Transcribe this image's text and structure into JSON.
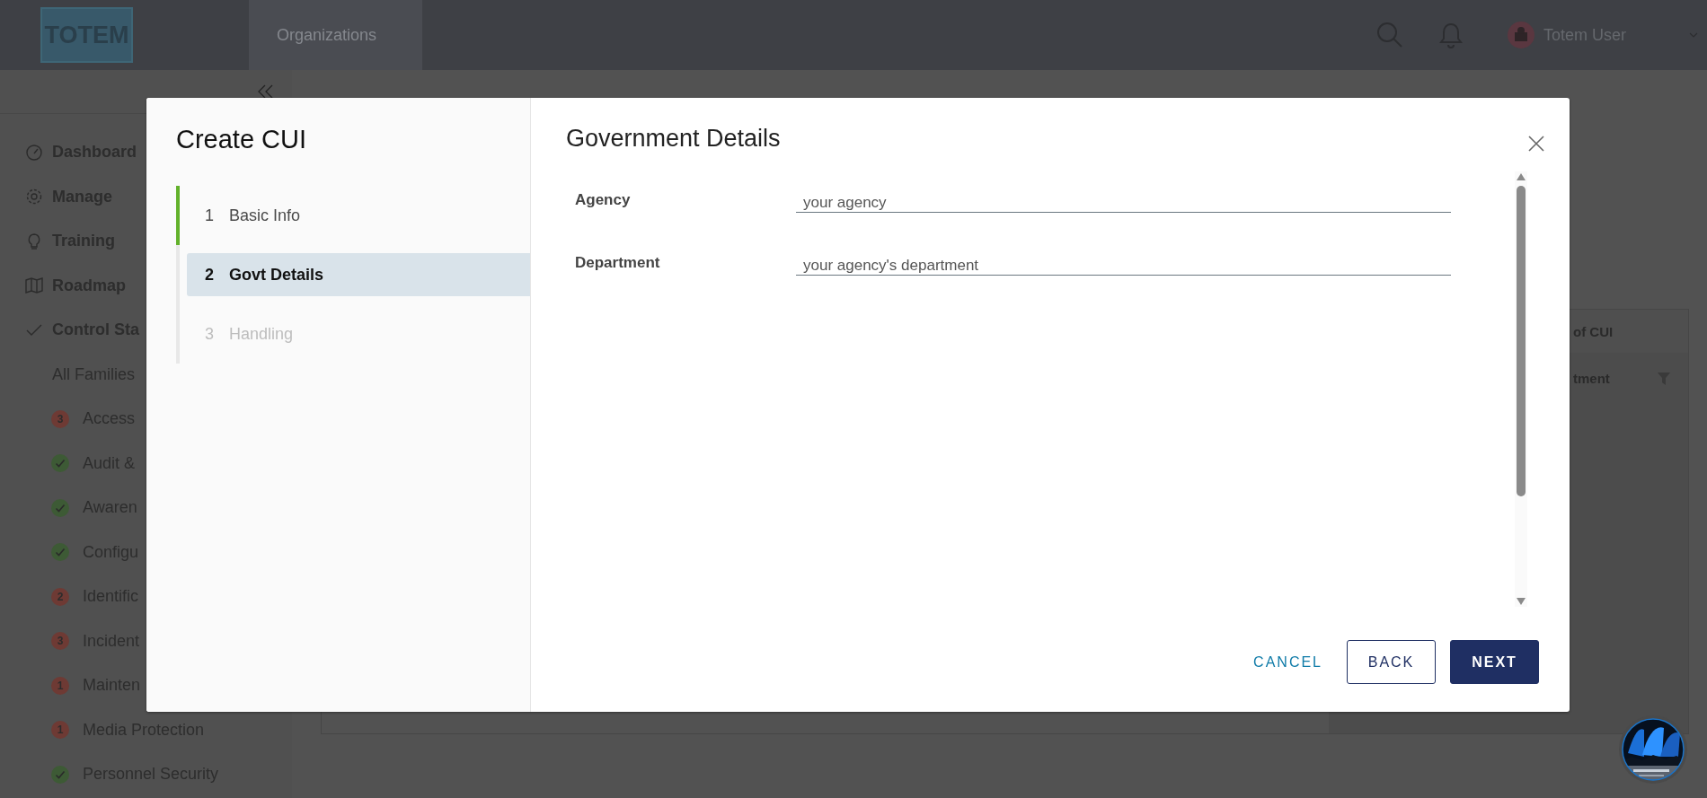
{
  "header": {
    "logo": "TOTEM",
    "nav": [
      {
        "label": "Organizations",
        "selected": true
      }
    ],
    "user": "Totem User"
  },
  "sidebar": {
    "items": [
      {
        "kind": "nav",
        "label": "Dashboard"
      },
      {
        "kind": "nav",
        "label": "Manage"
      },
      {
        "kind": "nav",
        "label": "Training"
      },
      {
        "kind": "nav",
        "label": "Roadmap"
      },
      {
        "kind": "nav",
        "label": "Control Sta"
      },
      {
        "kind": "sub",
        "label": "All Families"
      },
      {
        "kind": "family",
        "badge": "3",
        "color": "#6e3a34",
        "label": "Access"
      },
      {
        "kind": "family",
        "color": "#3d5a35",
        "label": "Audit &"
      },
      {
        "kind": "family",
        "color": "#3d5a35",
        "label": "Awaren"
      },
      {
        "kind": "family",
        "color": "#3d5a35",
        "label": "Configu"
      },
      {
        "kind": "family",
        "badge": "2",
        "color": "#6e3a34",
        "label": "Identific"
      },
      {
        "kind": "family",
        "badge": "3",
        "color": "#6e3a34",
        "label": "Incident"
      },
      {
        "kind": "family",
        "badge": "1",
        "color": "#6e3a34",
        "label": "Mainten"
      },
      {
        "kind": "family",
        "badge": "1",
        "color": "#6e3a34",
        "label": "Media Protection"
      },
      {
        "kind": "family",
        "color": "#3d5a35",
        "label": "Personnel Security"
      }
    ]
  },
  "background_table": {
    "header": "of CUI",
    "column": "tment"
  },
  "dialog": {
    "title": "Create CUI",
    "steps": [
      {
        "number": "1",
        "label": "Basic Info",
        "selected": false,
        "completed": true,
        "disabled": false
      },
      {
        "number": "2",
        "label": "Govt Details",
        "selected": true,
        "completed": false,
        "disabled": false
      },
      {
        "number": "3",
        "label": "Handling",
        "selected": false,
        "completed": false,
        "disabled": true
      }
    ],
    "section_title": "Government Details",
    "fields": [
      {
        "label": "Agency",
        "placeholder": "your agency"
      },
      {
        "label": "Department",
        "placeholder": "your agency's department"
      }
    ],
    "buttons": [
      {
        "kind": "flat",
        "label": "CANCEL"
      },
      {
        "kind": "outline",
        "label": "BACK"
      },
      {
        "kind": "solid",
        "label": "NEXT"
      }
    ]
  }
}
